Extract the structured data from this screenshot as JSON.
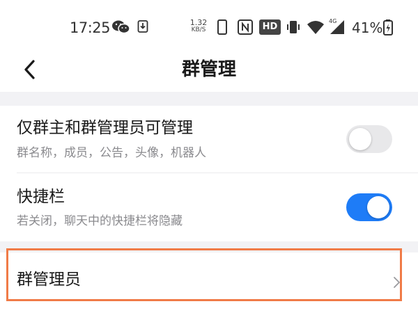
{
  "status_bar": {
    "time": "17:25",
    "net_speed_value": "1.32",
    "net_speed_unit": "KB/S",
    "hd_label": "HD",
    "signal_label": "4G",
    "battery": "41%",
    "icons": [
      "wechat-icon",
      "download-icon",
      "phone-icon",
      "nfc-icon",
      "vibrate-icon",
      "wifi-icon",
      "signal-icon",
      "battery-icon"
    ]
  },
  "header": {
    "title": "群管理",
    "back_icon": "chevron-left-icon"
  },
  "settings": [
    {
      "title": "仅群主和群管理员可管理",
      "subtitle": "群名称，成员，公告，头像，机器人",
      "toggle": "off"
    },
    {
      "title": "快捷栏",
      "subtitle": "若关闭，聊天中的快捷栏将隐藏",
      "toggle": "on"
    }
  ],
  "admin_row": {
    "title": "群管理员",
    "icon": "chevron-right-icon"
  },
  "colors": {
    "accent": "#1e7cf7",
    "toggle_off": "#e8e8ea",
    "highlight": "#f07b47",
    "section_gap": "#f2f2f5"
  }
}
